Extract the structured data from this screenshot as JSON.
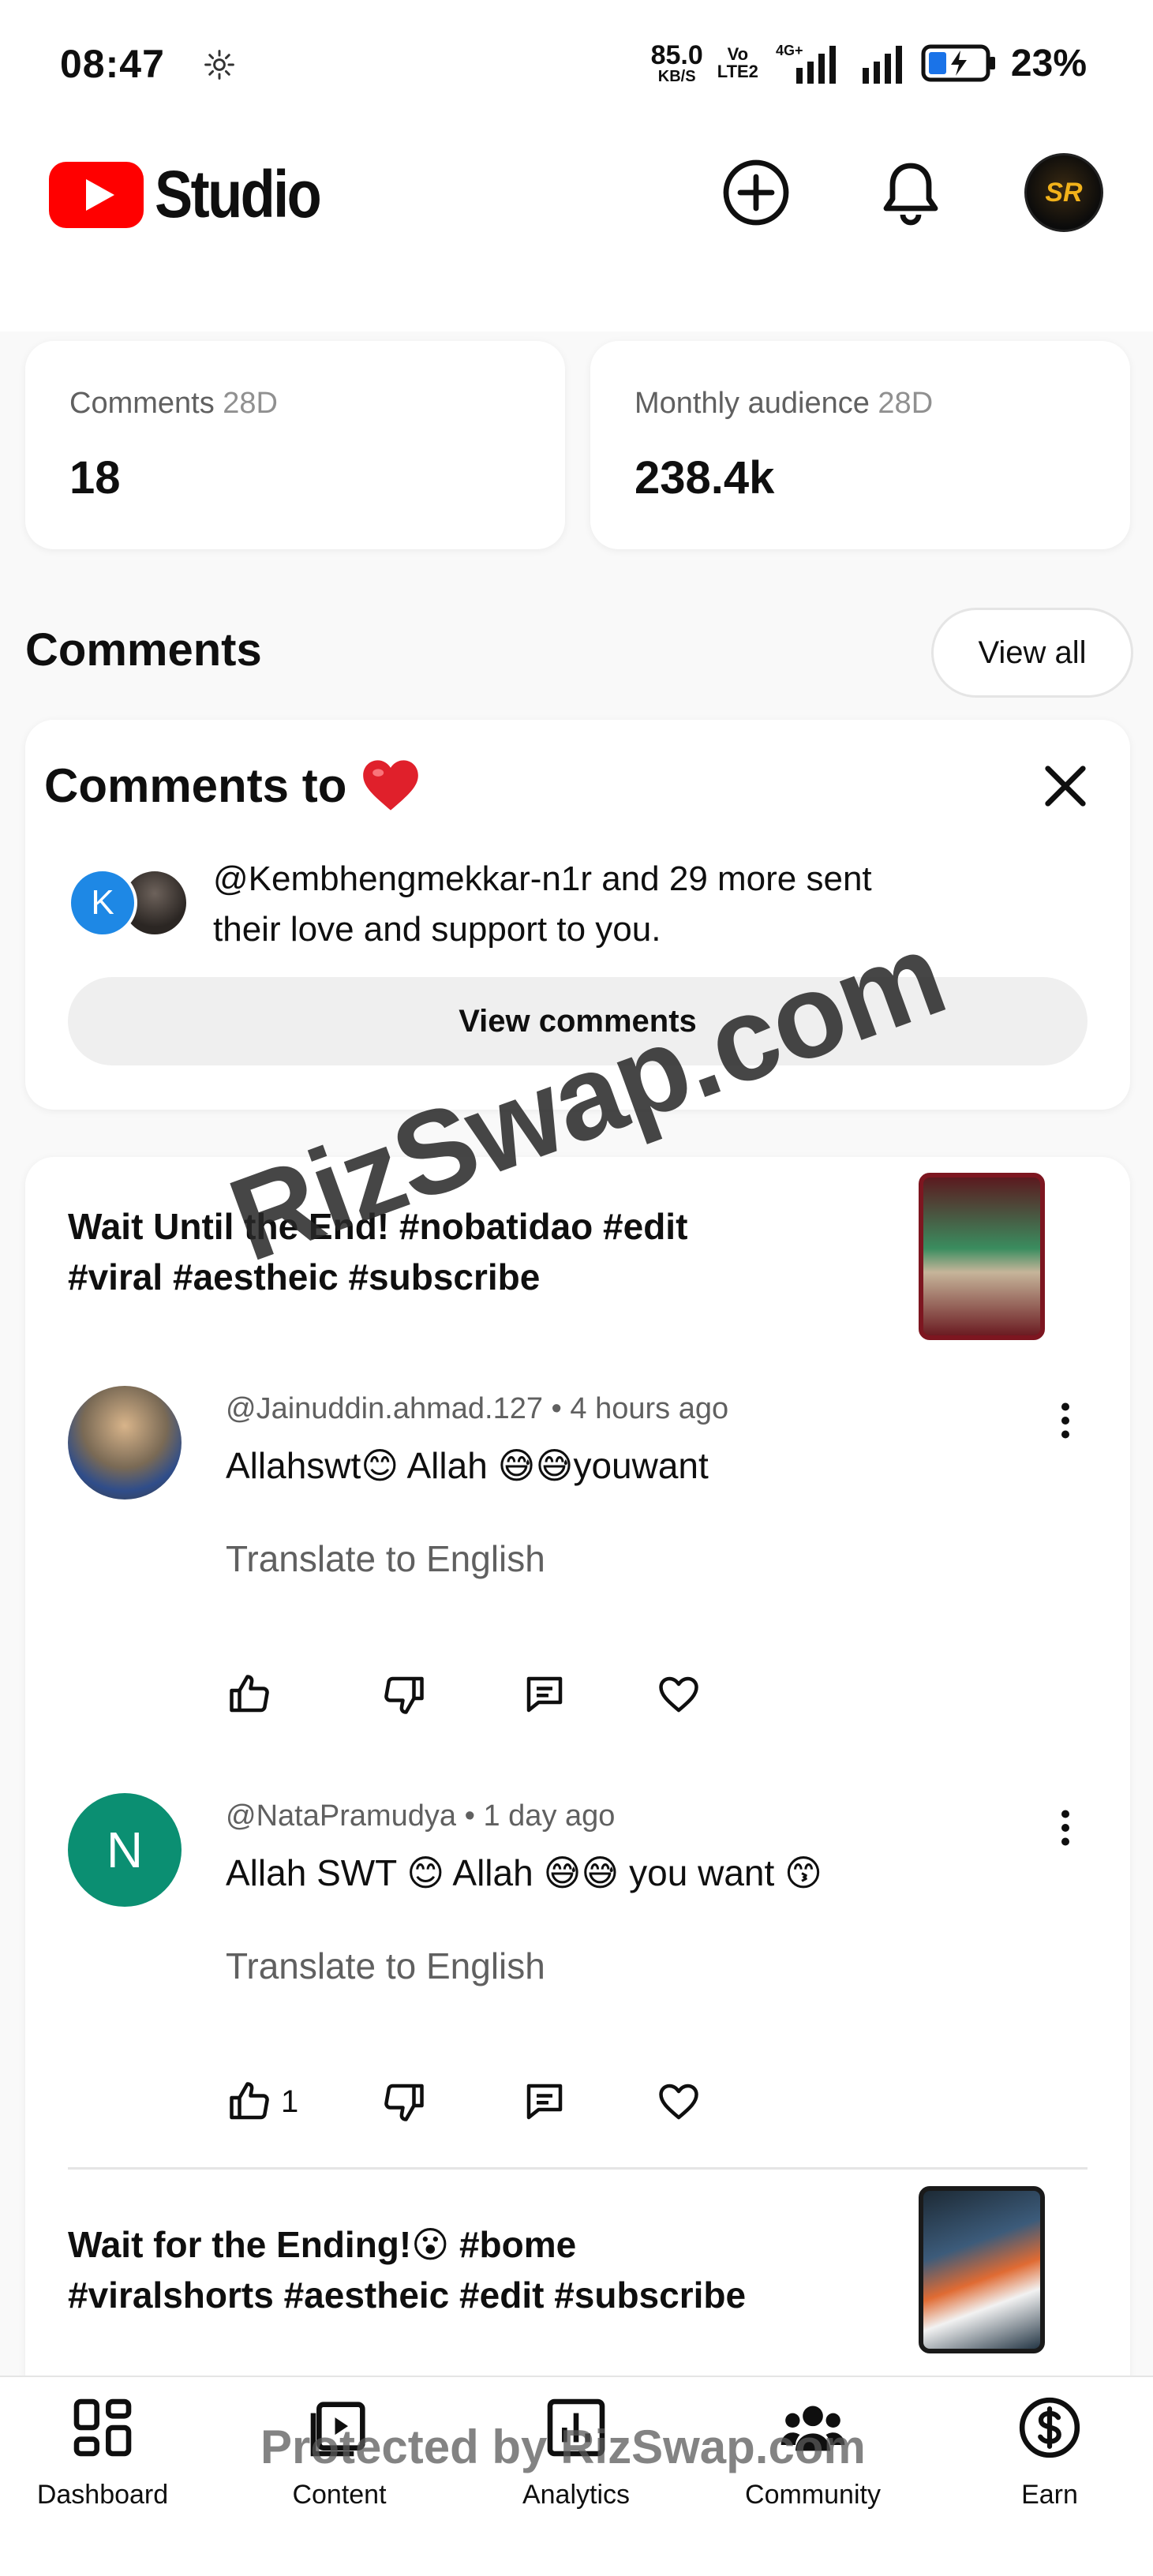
{
  "status_bar": {
    "time": "08:47",
    "net_speed_value": "85.0",
    "net_speed_unit": "KB/S",
    "volte_top": "Vo",
    "volte_bottom": "LTE2",
    "network_type": "4G+",
    "battery_percent": "23%"
  },
  "header": {
    "app_name": "Studio",
    "brand_color": "#ff0000",
    "avatar_label": "SR"
  },
  "stats": [
    {
      "label": "Comments",
      "period": "28D",
      "value": "18"
    },
    {
      "label": "Monthly audience",
      "period": "28D",
      "value": "238.4k"
    }
  ],
  "comments_section": {
    "title": "Comments",
    "view_all_label": "View all"
  },
  "promo_card": {
    "title": "Comments to",
    "emoji": "❤️",
    "avatar_letter": "K",
    "message_line1": "@Kembhengmekkar-n1r and 29 more sent",
    "message_line2": "their love and support to you.",
    "button_label": "View comments"
  },
  "videos": [
    {
      "title_line1": "Wait Until the End! #nobatidao #edit",
      "title_line2": "#viral #aestheic #subscribe",
      "comments": [
        {
          "author": "@Jainuddin.ahmad.127",
          "time": "4 hours ago",
          "text": "Allahswt😊 Allah 😅😅youwant",
          "translate_label": "Translate to English",
          "like_count": ""
        },
        {
          "author": "@NataPramudya",
          "avatar_letter": "N",
          "time": "1 day ago",
          "text": "Allah SWT 😊 Allah 😅😅 you want 😙",
          "translate_label": "Translate to English",
          "like_count": "1"
        }
      ]
    },
    {
      "title_line1": "Wait for the Ending!😮 #bome",
      "title_line2": "#viralshorts #aestheic #edit #subscribe"
    }
  ],
  "bottom_nav": [
    {
      "label": "Dashboard",
      "icon": "dashboard-icon"
    },
    {
      "label": "Content",
      "icon": "content-icon"
    },
    {
      "label": "Analytics",
      "icon": "analytics-icon"
    },
    {
      "label": "Community",
      "icon": "community-icon"
    },
    {
      "label": "Earn",
      "icon": "earn-icon"
    }
  ],
  "watermarks": {
    "diagonal": "RizSwap.com",
    "footer": "Protected by RizSwap.com"
  }
}
